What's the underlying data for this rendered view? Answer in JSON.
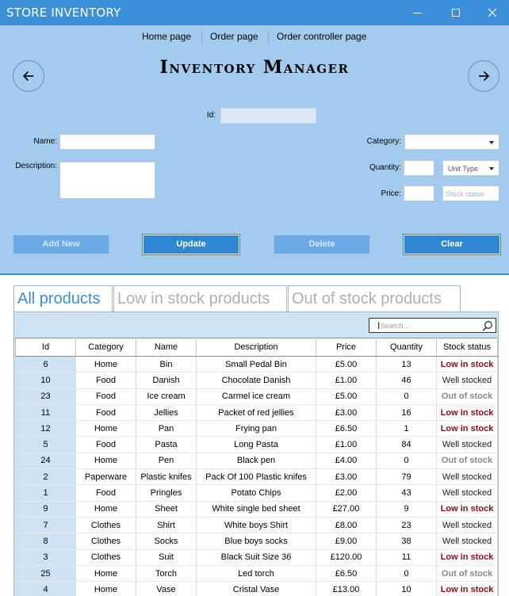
{
  "window": {
    "title": "STORE INVENTORY"
  },
  "nav": {
    "items": [
      "Home page",
      "Order page",
      "Order controller page"
    ]
  },
  "heading": "Inventory Manager",
  "form": {
    "id_label": "Id:",
    "name_label": "Name:",
    "description_label": "Description:",
    "category_label": "Category:",
    "quantity_label": "Quantity:",
    "price_label": "Price:",
    "unit_type_value": "Unit Type",
    "stock_status_placeholder": "Stock status"
  },
  "buttons": {
    "add": "Add New",
    "update": "Update",
    "delete": "Delete",
    "clear": "Clear"
  },
  "tabs": [
    "All products",
    "Low in stock products",
    "Out of stock products"
  ],
  "search": {
    "placeholder": "Search..."
  },
  "table": {
    "columns": [
      "Id",
      "Category",
      "Name",
      "Description",
      "Price",
      "Quantity",
      "Stock status"
    ],
    "rows": [
      [
        "6",
        "Home",
        "Bin",
        "Small Pedal Bin",
        "£5.00",
        "13",
        "Low in stock"
      ],
      [
        "10",
        "Food",
        "Danish",
        "Chocolate Danish",
        "£1.00",
        "46",
        "Well stocked"
      ],
      [
        "23",
        "Food",
        "Ice cream",
        "Carmel ice cream",
        "£5.00",
        "0",
        "Out of stock"
      ],
      [
        "11",
        "Food",
        "Jellies",
        "Packet of red jellies",
        "£3.00",
        "16",
        "Low in stock"
      ],
      [
        "12",
        "Home",
        "Pan",
        "Frying pan",
        "£6.50",
        "1",
        "Low in stock"
      ],
      [
        "5",
        "Food",
        "Pasta",
        "Long Pasta",
        "£1.00",
        "84",
        "Well stocked"
      ],
      [
        "24",
        "Home",
        "Pen",
        "Black pen",
        "£4.00",
        "0",
        "Out of stock"
      ],
      [
        "2",
        "Paperware",
        "Plastic knifes",
        "Pack Of 100 Plastic knifes",
        "£3.00",
        "79",
        "Well stocked"
      ],
      [
        "1",
        "Food",
        "Pringles",
        "Potato Chips",
        "£2.00",
        "43",
        "Well stocked"
      ],
      [
        "9",
        "Home",
        "Sheet",
        "White single bed sheet",
        "£27.00",
        "9",
        "Low in stock"
      ],
      [
        "7",
        "Clothes",
        "Shirt",
        "White boys Shirt",
        "£8.00",
        "23",
        "Well stocked"
      ],
      [
        "8",
        "Clothes",
        "Socks",
        "Blue boys socks",
        "£9.00",
        "38",
        "Well stocked"
      ],
      [
        "3",
        "Clothes",
        "Suit",
        "Black Suit Size 36",
        "£120.00",
        "11",
        "Low in stock"
      ],
      [
        "25",
        "Home",
        "Torch",
        "Led torch",
        "£6.50",
        "0",
        "Out of stock"
      ],
      [
        "4",
        "Home",
        "Vase",
        "Cristal Vase",
        "£13.00",
        "10",
        "Low in stock"
      ]
    ]
  },
  "colors": {
    "titlebar": "#3a8fd8",
    "panel": "#a3cbee",
    "low_stock": "#8a0c1e",
    "out_of_stock": "#888888"
  },
  "icons": {
    "back": "arrow-left-icon",
    "forward": "arrow-right-icon",
    "search": "magnifier-icon"
  }
}
